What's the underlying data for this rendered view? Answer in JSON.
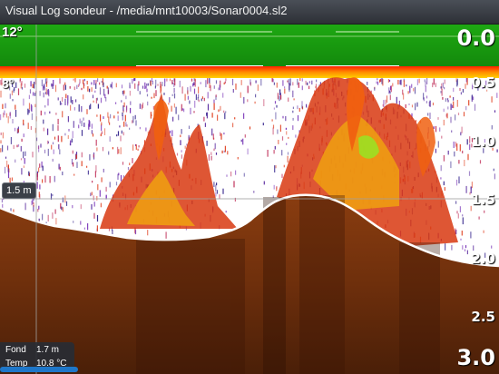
{
  "window": {
    "title": "Visual Log sondeur - /media/mnt10003/Sonar0004.sl2"
  },
  "overlay": {
    "surface_temp": "12°",
    "water_temp_marker": "8°",
    "cursor_depth": "1.5 m",
    "bottom_info": {
      "depth_label": "Fond",
      "depth_value": "1.7  m",
      "temp_label": "Temp",
      "temp_value": "10.8 °C"
    }
  },
  "depth_scale": {
    "labels": [
      "0.0",
      "0.5",
      "1.0",
      "1.5",
      "2.0",
      "2.5",
      "3.0"
    ]
  },
  "colors": {
    "surface_band": "#16a00e",
    "bottom_line": "#ffffff",
    "sediment": "#8a3d10",
    "fish_arch": "#e03010",
    "scatter_dots": "#6a2ca8",
    "cursor_line": "#a0a0a0",
    "scrollbar": "#1f77c9"
  }
}
